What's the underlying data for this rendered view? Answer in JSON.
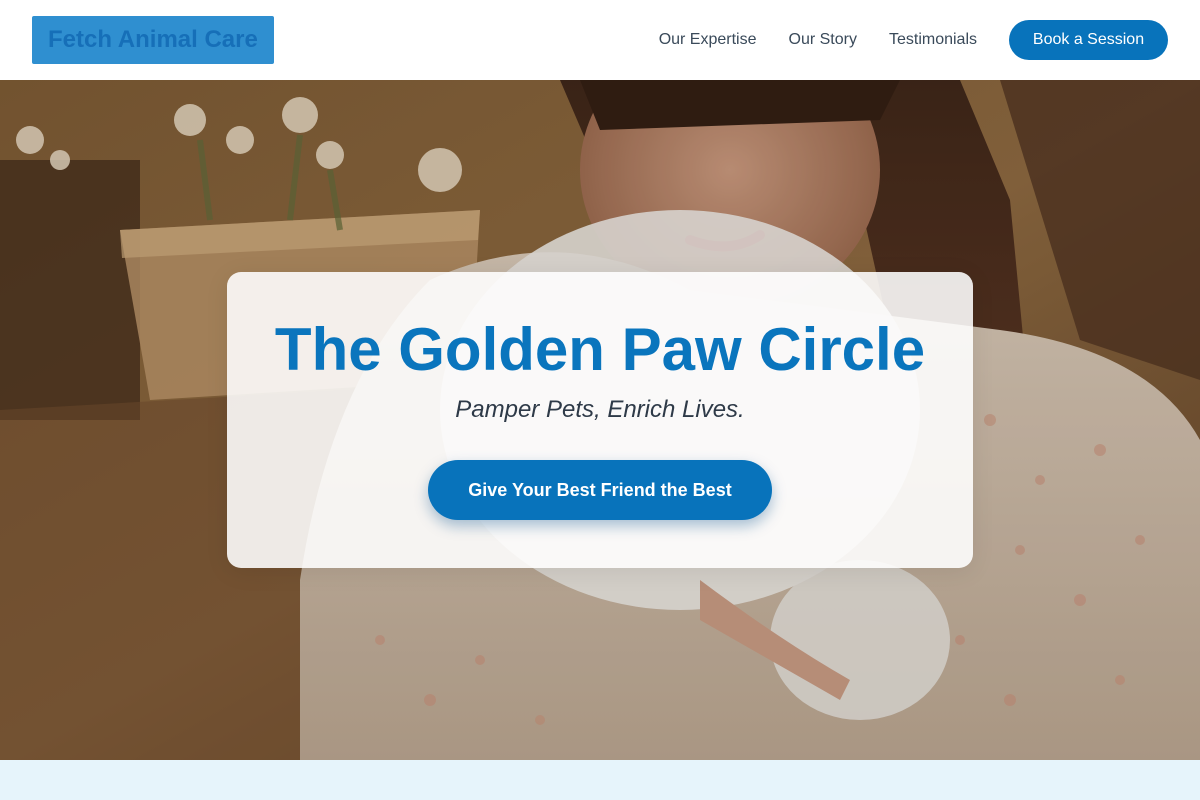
{
  "header": {
    "logo_text": "Fetch Animal Care",
    "nav": [
      {
        "label": "Our Expertise"
      },
      {
        "label": "Our Story"
      },
      {
        "label": "Testimonials"
      }
    ],
    "cta_label": "Book a Session"
  },
  "hero": {
    "image_icon": "woman-holding-white-puppy-photo",
    "title": "The Golden Paw Circle",
    "subtitle": "Pamper Pets, Enrich Lives.",
    "cta_label": "Give Your Best Friend the Best"
  },
  "colors": {
    "brand": "#0873bb",
    "title": "#0a75bd",
    "logo_bg": "#2f8fd0",
    "section_bg": "#e6f4fb"
  }
}
